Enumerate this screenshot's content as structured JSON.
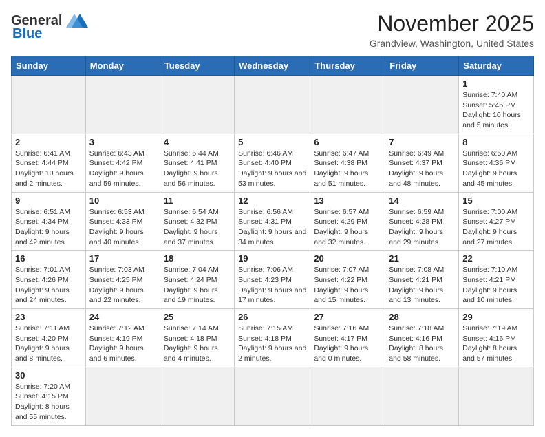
{
  "header": {
    "logo_general": "General",
    "logo_blue": "Blue",
    "month": "November 2025",
    "location": "Grandview, Washington, United States"
  },
  "days_of_week": [
    "Sunday",
    "Monday",
    "Tuesday",
    "Wednesday",
    "Thursday",
    "Friday",
    "Saturday"
  ],
  "weeks": [
    [
      {
        "day": "",
        "info": ""
      },
      {
        "day": "",
        "info": ""
      },
      {
        "day": "",
        "info": ""
      },
      {
        "day": "",
        "info": ""
      },
      {
        "day": "",
        "info": ""
      },
      {
        "day": "",
        "info": ""
      },
      {
        "day": "1",
        "info": "Sunrise: 7:40 AM\nSunset: 5:45 PM\nDaylight: 10 hours and 5 minutes."
      }
    ],
    [
      {
        "day": "2",
        "info": "Sunrise: 6:41 AM\nSunset: 4:44 PM\nDaylight: 10 hours and 2 minutes."
      },
      {
        "day": "3",
        "info": "Sunrise: 6:43 AM\nSunset: 4:42 PM\nDaylight: 9 hours and 59 minutes."
      },
      {
        "day": "4",
        "info": "Sunrise: 6:44 AM\nSunset: 4:41 PM\nDaylight: 9 hours and 56 minutes."
      },
      {
        "day": "5",
        "info": "Sunrise: 6:46 AM\nSunset: 4:40 PM\nDaylight: 9 hours and 53 minutes."
      },
      {
        "day": "6",
        "info": "Sunrise: 6:47 AM\nSunset: 4:38 PM\nDaylight: 9 hours and 51 minutes."
      },
      {
        "day": "7",
        "info": "Sunrise: 6:49 AM\nSunset: 4:37 PM\nDaylight: 9 hours and 48 minutes."
      },
      {
        "day": "8",
        "info": "Sunrise: 6:50 AM\nSunset: 4:36 PM\nDaylight: 9 hours and 45 minutes."
      }
    ],
    [
      {
        "day": "9",
        "info": "Sunrise: 6:51 AM\nSunset: 4:34 PM\nDaylight: 9 hours and 42 minutes."
      },
      {
        "day": "10",
        "info": "Sunrise: 6:53 AM\nSunset: 4:33 PM\nDaylight: 9 hours and 40 minutes."
      },
      {
        "day": "11",
        "info": "Sunrise: 6:54 AM\nSunset: 4:32 PM\nDaylight: 9 hours and 37 minutes."
      },
      {
        "day": "12",
        "info": "Sunrise: 6:56 AM\nSunset: 4:31 PM\nDaylight: 9 hours and 34 minutes."
      },
      {
        "day": "13",
        "info": "Sunrise: 6:57 AM\nSunset: 4:29 PM\nDaylight: 9 hours and 32 minutes."
      },
      {
        "day": "14",
        "info": "Sunrise: 6:59 AM\nSunset: 4:28 PM\nDaylight: 9 hours and 29 minutes."
      },
      {
        "day": "15",
        "info": "Sunrise: 7:00 AM\nSunset: 4:27 PM\nDaylight: 9 hours and 27 minutes."
      }
    ],
    [
      {
        "day": "16",
        "info": "Sunrise: 7:01 AM\nSunset: 4:26 PM\nDaylight: 9 hours and 24 minutes."
      },
      {
        "day": "17",
        "info": "Sunrise: 7:03 AM\nSunset: 4:25 PM\nDaylight: 9 hours and 22 minutes."
      },
      {
        "day": "18",
        "info": "Sunrise: 7:04 AM\nSunset: 4:24 PM\nDaylight: 9 hours and 19 minutes."
      },
      {
        "day": "19",
        "info": "Sunrise: 7:06 AM\nSunset: 4:23 PM\nDaylight: 9 hours and 17 minutes."
      },
      {
        "day": "20",
        "info": "Sunrise: 7:07 AM\nSunset: 4:22 PM\nDaylight: 9 hours and 15 minutes."
      },
      {
        "day": "21",
        "info": "Sunrise: 7:08 AM\nSunset: 4:21 PM\nDaylight: 9 hours and 13 minutes."
      },
      {
        "day": "22",
        "info": "Sunrise: 7:10 AM\nSunset: 4:21 PM\nDaylight: 9 hours and 10 minutes."
      }
    ],
    [
      {
        "day": "23",
        "info": "Sunrise: 7:11 AM\nSunset: 4:20 PM\nDaylight: 9 hours and 8 minutes."
      },
      {
        "day": "24",
        "info": "Sunrise: 7:12 AM\nSunset: 4:19 PM\nDaylight: 9 hours and 6 minutes."
      },
      {
        "day": "25",
        "info": "Sunrise: 7:14 AM\nSunset: 4:18 PM\nDaylight: 9 hours and 4 minutes."
      },
      {
        "day": "26",
        "info": "Sunrise: 7:15 AM\nSunset: 4:18 PM\nDaylight: 9 hours and 2 minutes."
      },
      {
        "day": "27",
        "info": "Sunrise: 7:16 AM\nSunset: 4:17 PM\nDaylight: 9 hours and 0 minutes."
      },
      {
        "day": "28",
        "info": "Sunrise: 7:18 AM\nSunset: 4:16 PM\nDaylight: 8 hours and 58 minutes."
      },
      {
        "day": "29",
        "info": "Sunrise: 7:19 AM\nSunset: 4:16 PM\nDaylight: 8 hours and 57 minutes."
      }
    ],
    [
      {
        "day": "30",
        "info": "Sunrise: 7:20 AM\nSunset: 4:15 PM\nDaylight: 8 hours and 55 minutes."
      },
      {
        "day": "",
        "info": ""
      },
      {
        "day": "",
        "info": ""
      },
      {
        "day": "",
        "info": ""
      },
      {
        "day": "",
        "info": ""
      },
      {
        "day": "",
        "info": ""
      },
      {
        "day": "",
        "info": ""
      }
    ]
  ]
}
